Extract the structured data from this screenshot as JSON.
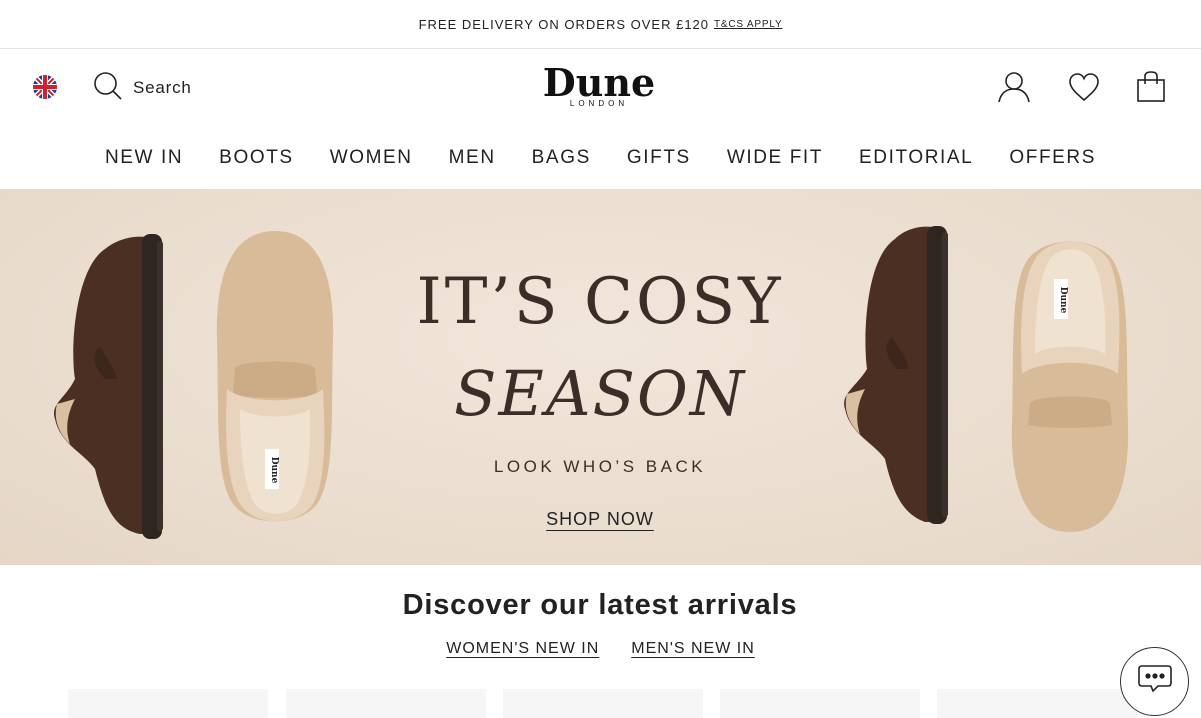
{
  "promo": {
    "text": "FREE DELIVERY ON ORDERS OVER £120",
    "link": "T&CS APPLY"
  },
  "header": {
    "search_label": "Search",
    "logo": {
      "brand": "Dune",
      "sub": "LONDON"
    }
  },
  "nav": {
    "items": [
      "NEW IN",
      "BOOTS",
      "WOMEN",
      "MEN",
      "BAGS",
      "GIFTS",
      "WIDE FIT",
      "EDITORIAL",
      "OFFERS"
    ]
  },
  "hero": {
    "title_line1": "IT’S COSY",
    "title_line2": "SEASON",
    "subtitle": "LOOK WHO’S BACK",
    "cta": "SHOP NOW",
    "shoe_label": "Dune"
  },
  "arrivals": {
    "title": "Discover our latest arrivals",
    "links": [
      "WOMEN'S NEW IN",
      "MEN'S NEW IN"
    ]
  },
  "colors": {
    "hero_bg": "#ecdfd2",
    "hero_text": "#3b2e28",
    "dark_suede": "#4a2f22",
    "light_suede": "#d8bb98"
  }
}
